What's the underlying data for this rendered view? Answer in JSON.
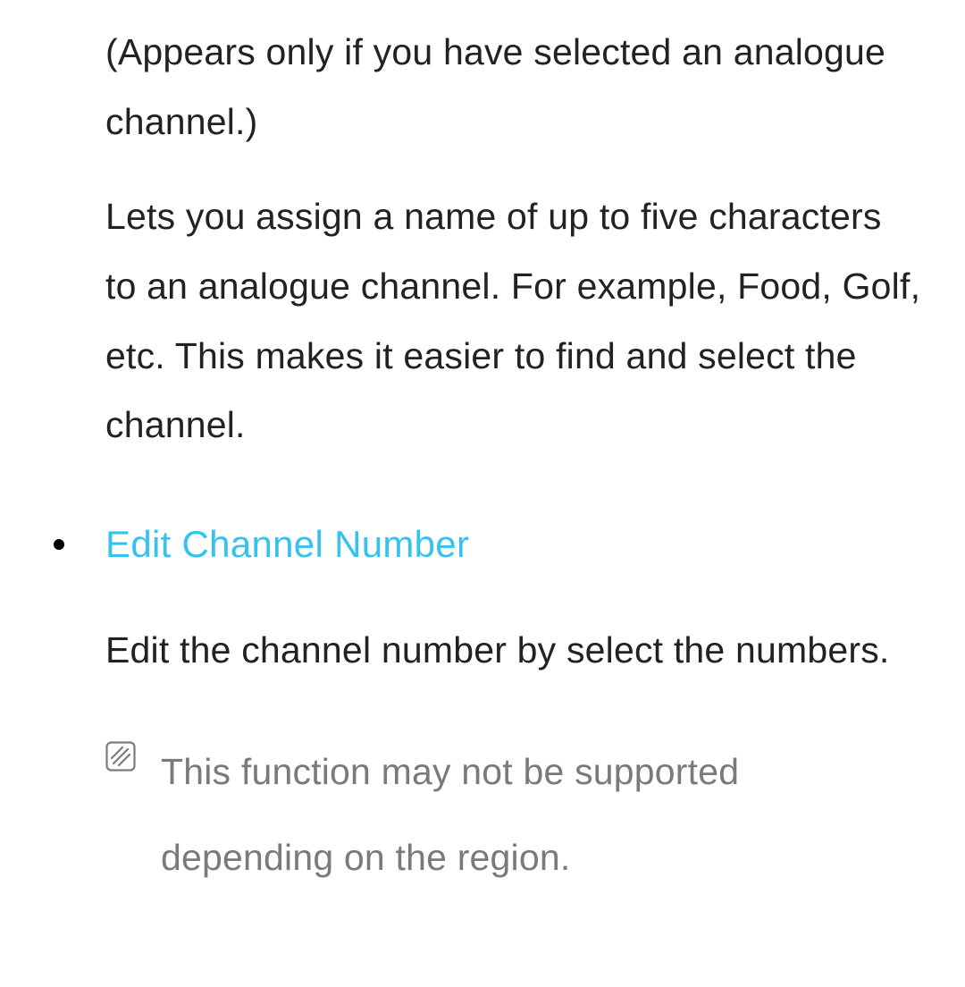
{
  "intro": {
    "condition": "(Appears only if you have selected an analogue channel.)",
    "description": "Lets you assign a name of up to five characters to an analogue channel. For example, Food, Golf, etc. This makes it easier to find and select the channel."
  },
  "bullet": {
    "title": "Edit Channel Number",
    "description": "Edit the channel number by select the numbers."
  },
  "note": {
    "text": "This function may not be supported depending on the region.",
    "icon_name": "note-icon"
  },
  "colors": {
    "accent": "#33c3ee",
    "muted": "#7a7a7a",
    "body": "#222222"
  }
}
